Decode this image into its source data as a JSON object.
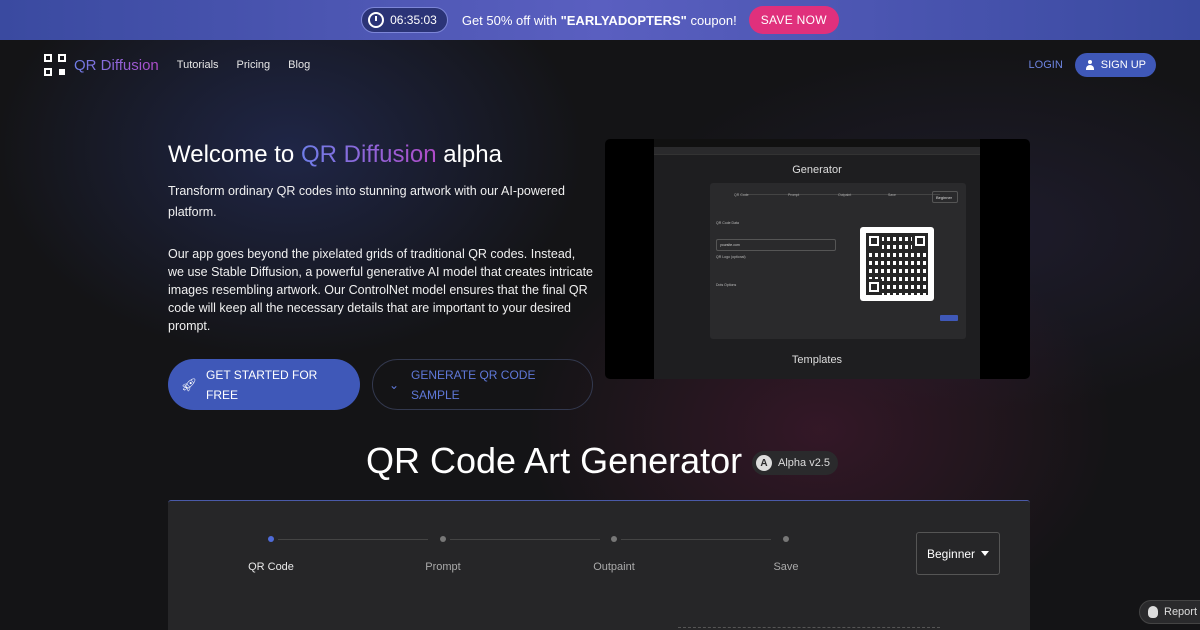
{
  "colors": {
    "accent": "#3f58b8",
    "brand_grad_start": "#6f7ee8",
    "brand_grad_end": "#b04bc8",
    "promo_pink": "#e0307c"
  },
  "promo": {
    "timer": "06:35:03",
    "text_prefix": "Get 50% off with ",
    "code": "\"EARLYADOPTERS\"",
    "text_suffix": " coupon!",
    "cta": "SAVE NOW"
  },
  "nav": {
    "brand": "QR Diffusion",
    "links": [
      "Tutorials",
      "Pricing",
      "Blog"
    ],
    "login": "LOGIN",
    "signup": "SIGN UP"
  },
  "hero": {
    "title_prefix": "Welcome to ",
    "title_brand": "QR Diffusion",
    "title_suffix": " alpha",
    "p1": "Transform ordinary QR codes into stunning artwork with our AI-powered platform.",
    "p2": "Our app goes beyond the pixelated grids of traditional QR codes. Instead, we use Stable Diffusion, a powerful generative AI model that creates intricate images resembling artwork. Our ControlNet model ensures that the final QR code will keep all the necessary details that are important to your desired prompt.",
    "cta_primary": "GET STARTED FOR FREE",
    "cta_secondary": "GENERATE QR CODE SAMPLE"
  },
  "preview": {
    "title": "Generator",
    "steps": [
      "QR Code",
      "Prompt",
      "Outpaint",
      "Save"
    ],
    "level": "Beginner",
    "qr_label": "QR Code Data",
    "input_value": "yoursite.com",
    "logo_label": "QR Logo (optional)",
    "style_label": "Dots Options",
    "templates": "Templates"
  },
  "generator": {
    "title": "QR Code Art Generator",
    "badge": "Alpha v2.5",
    "badge_icon": "A",
    "steps": [
      "QR Code",
      "Prompt",
      "Outpaint",
      "Save"
    ],
    "level": "Beginner"
  },
  "report": {
    "label": "Report B"
  }
}
